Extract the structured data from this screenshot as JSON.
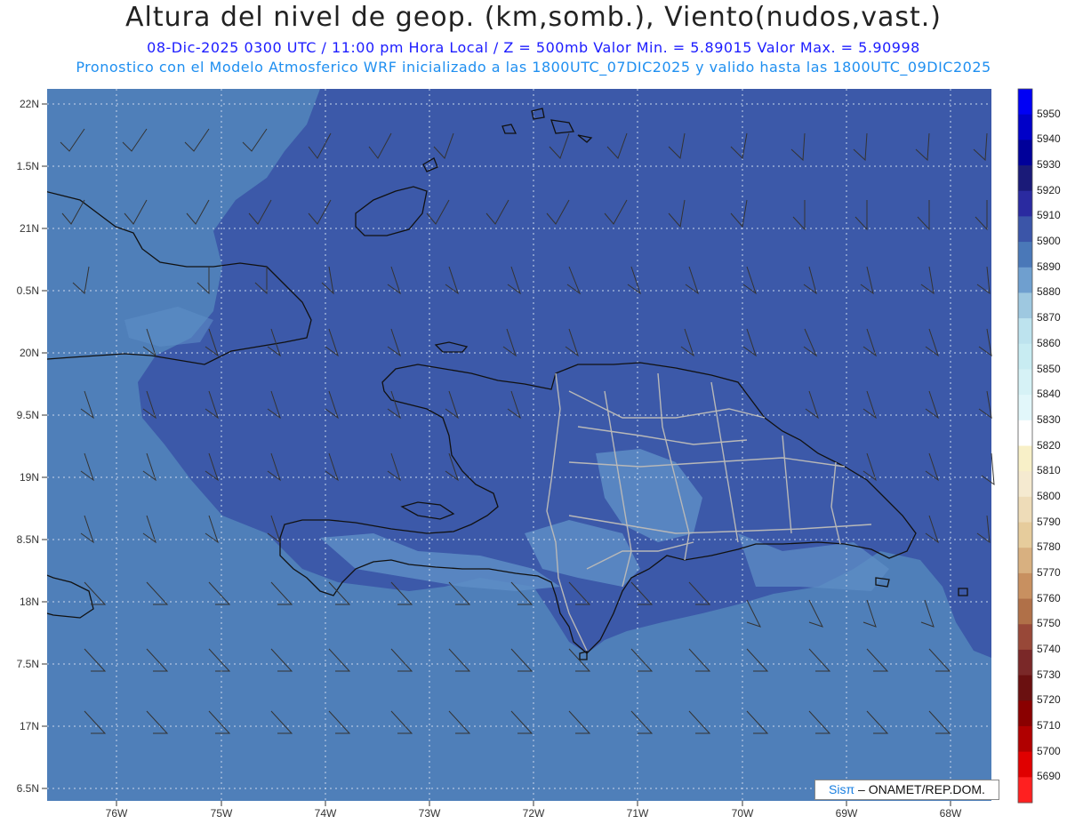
{
  "header": {
    "title": "Altura del nivel de geop. (km,somb.), Viento(nudos,vast.)",
    "subtitle_line1": "08-Dic-2025  0300 UTC / 11:00 pm Hora Local / Z = 500mb    Valor Min. = 5.89015   Valor Max. = 5.90998",
    "subtitle_line2": "Pronostico con el Modelo Atmosferico WRF inicializado a las 1800UTC_07DIC2025 y valido hasta las  1800UTC_09DIC2025"
  },
  "axes": {
    "lat_labels": [
      "22N",
      "1.5N",
      "21N",
      "0.5N",
      "20N",
      "9.5N",
      "19N",
      "8.5N",
      "18N",
      "7.5N",
      "17N",
      "6.5N"
    ],
    "lon_labels": [
      "76W",
      "75W",
      "74W",
      "73W",
      "72W",
      "71W",
      "70W",
      "69W",
      "68W"
    ]
  },
  "colorbar": {
    "levels": [
      "5950",
      "5940",
      "5930",
      "5920",
      "5910",
      "5900",
      "5890",
      "5880",
      "5870",
      "5860",
      "5850",
      "5840",
      "5830",
      "5820",
      "5810",
      "5800",
      "5790",
      "5780",
      "5770",
      "5760",
      "5750",
      "5740",
      "5730",
      "5720",
      "5710",
      "5700",
      "5690"
    ],
    "colors": [
      "#0000f5",
      "#0000c8",
      "#00009a",
      "#1a1a78",
      "#2a2aa0",
      "#3b55a8",
      "#4a78b8",
      "#6f9fcf",
      "#9ec8e0",
      "#bde3ee",
      "#c8ecf2",
      "#d6f2f6",
      "#e2f7fa",
      "#ffffff",
      "#f8f0c8",
      "#f5ead0",
      "#eedcb8",
      "#e6cc9c",
      "#d8b080",
      "#c89060",
      "#b07048",
      "#984838",
      "#7a2828",
      "#6a1010",
      "#8a0000",
      "#b00000",
      "#e00000",
      "#ff2020"
    ]
  },
  "field_colors": {
    "ocean_low": "#4f7fb9",
    "main": "#3c59a9",
    "mid": "#5d8dc6",
    "coast": "#111111",
    "borders": "#b8b8b8"
  },
  "credit": {
    "brand": "Sisπ",
    "text": " – ONAMET/REP.DOM."
  }
}
